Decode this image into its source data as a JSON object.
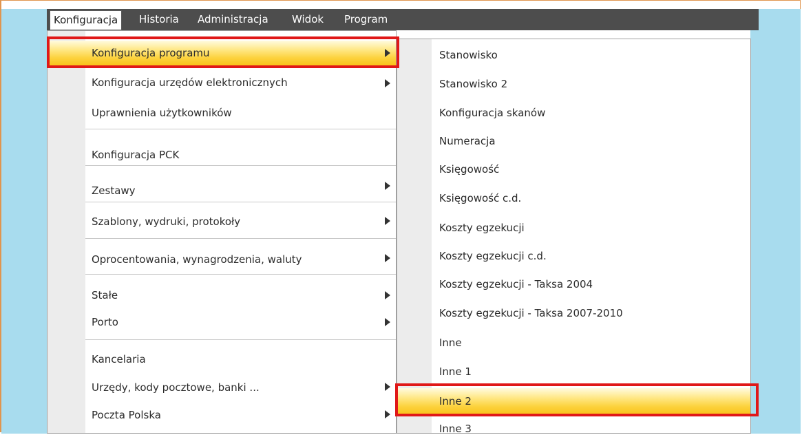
{
  "menubar": {
    "items": [
      "Konfiguracja",
      "Historia",
      "Administracja",
      "Widok",
      "Program"
    ]
  },
  "main_menu": {
    "items": [
      {
        "label": "Konfiguracja programu",
        "submenu": true
      },
      {
        "label": "Konfiguracja urzędów elektronicznych",
        "submenu": true
      },
      {
        "label": "Uprawnienia użytkowników",
        "submenu": false
      },
      {
        "label": "Konfiguracja PCK",
        "submenu": false
      },
      {
        "label": "Zestawy",
        "submenu": true
      },
      {
        "label": "Szablony, wydruki, protokoły",
        "submenu": true
      },
      {
        "label": "Oprocentowania, wynagrodzenia, waluty",
        "submenu": true
      },
      {
        "label": "Stałe",
        "submenu": true
      },
      {
        "label": "Porto",
        "submenu": true
      },
      {
        "label": "Kancelaria",
        "submenu": false
      },
      {
        "label": "Urzędy, kody pocztowe, banki ...",
        "submenu": true
      },
      {
        "label": "Poczta Polska",
        "submenu": true
      }
    ]
  },
  "sub_menu": {
    "items": [
      "Stanowisko",
      "Stanowisko 2",
      "Konfiguracja skanów",
      "Numeracja",
      "Księgowość",
      "Księgowość c.d.",
      "Koszty egzekucji",
      "Koszty egzekucji c.d.",
      "Koszty egzekucji - Taksa 2004",
      "Koszty egzekucji - Taksa 2007-2010",
      "Inne",
      "Inne 1",
      "Inne 2",
      "Inne 3"
    ]
  },
  "colors": {
    "highlight_top": "#fffbe0",
    "highlight_bottom": "#f9c21a",
    "annotation_red": "#e01818",
    "menubar_bg": "#4d4d4d",
    "background_blue": "#a8dcee"
  }
}
